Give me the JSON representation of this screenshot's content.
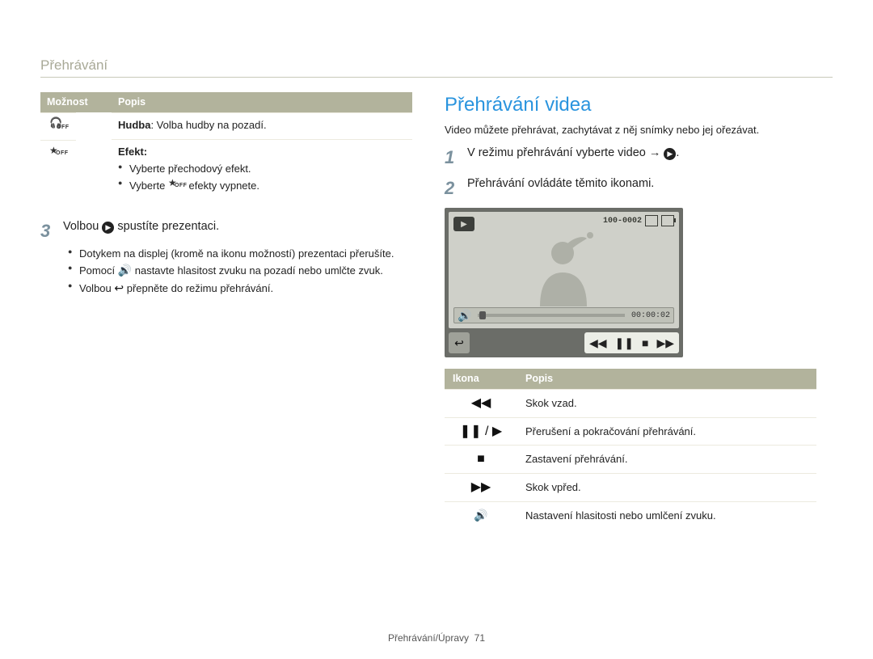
{
  "header": {
    "running_title": "Přehrávání"
  },
  "left": {
    "table": {
      "head_opt": "Možnost",
      "head_desc": "Popis",
      "row1_desc_bold": "Hudba",
      "row1_desc_rest": ": Volba hudby na pozadí.",
      "row2_title": "Efekt",
      "row2_b1": "Vyberte přechodový efekt.",
      "row2_b2a": "Vyberte ",
      "row2_b2b": " efekty vypnete."
    },
    "step3_num": "3",
    "step3_a": "Volbou ",
    "step3_b": " spustíte prezentaci.",
    "bul1": "Dotykem na displej (kromě na ikonu možností) prezentaci přerušíte.",
    "bul2a": "Pomocí ",
    "bul2b": " nastavte hlasitost zvuku na pozadí nebo umlčte zvuk.",
    "bul3a": "Volbou ",
    "bul3b": " přepněte do režimu přehrávání."
  },
  "right": {
    "title": "Přehrávání videa",
    "intro": "Video můžete přehrávat, zachytávat z něj snímky nebo jej ořezávat.",
    "s1_num": "1",
    "s1_a": "V režimu přehrávání vyberte video → ",
    "s1_b": ".",
    "s2_num": "2",
    "s2_text": "Přehrávání ovládáte těmito ikonami.",
    "player": {
      "file_counter": "100-0002",
      "time": "00:00:02"
    },
    "icons_table": {
      "head_icon": "Ikona",
      "head_desc": "Popis",
      "r1": "Skok vzad.",
      "r2": "Přerušení a pokračování přehrávání.",
      "r3": "Zastavení přehrávání.",
      "r4": "Skok vpřed.",
      "r5": "Nastavení hlasitosti nebo umlčení zvuku."
    }
  },
  "footer": {
    "section": "Přehrávání/Úpravy",
    "page": "71"
  }
}
